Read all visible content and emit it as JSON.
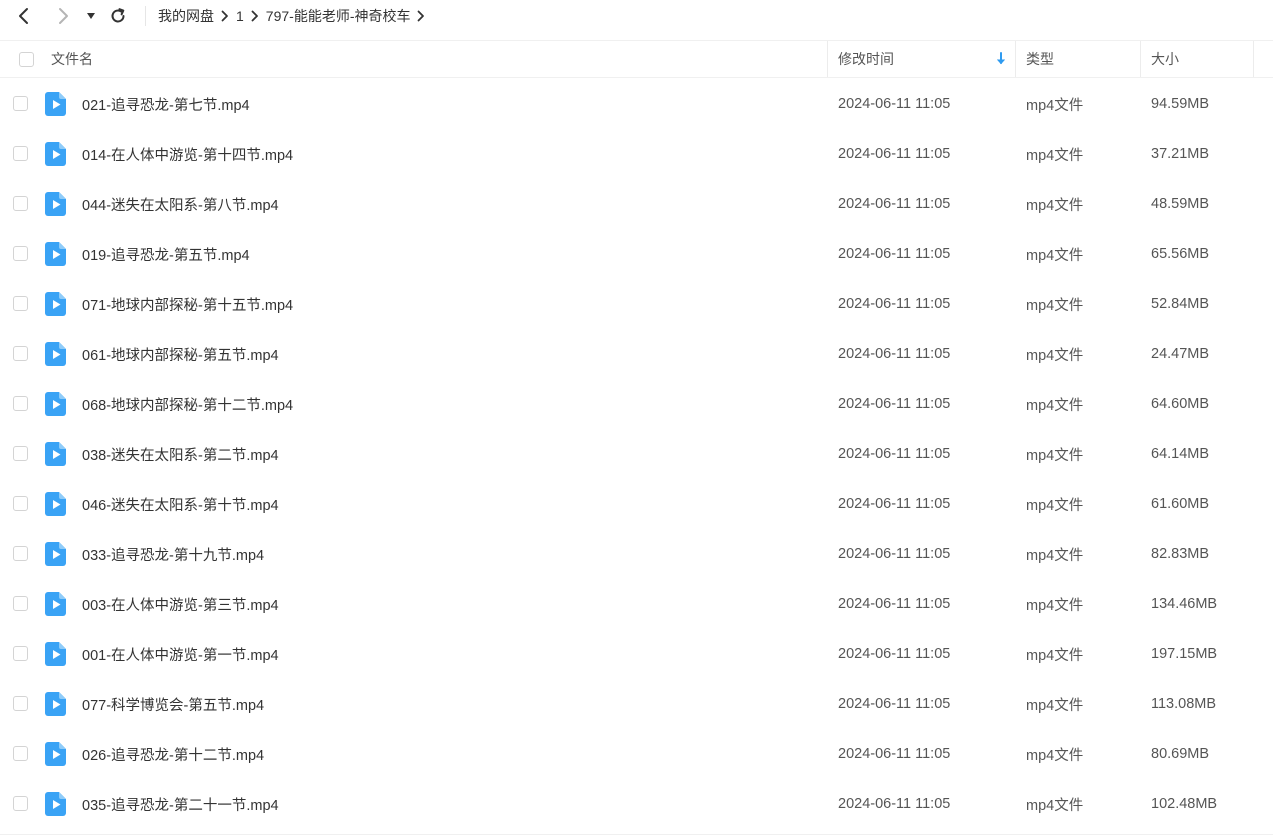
{
  "nav": {
    "back_icon": "chevron-left-icon",
    "forward_icon": "chevron-right-icon",
    "dropdown_icon": "caret-down-icon",
    "refresh_icon": "refresh-icon"
  },
  "breadcrumb": [
    "我的网盘",
    "1",
    "797-能能老师-神奇校车"
  ],
  "columns": {
    "name": "文件名",
    "modified": "修改时间",
    "type": "类型",
    "size": "大小"
  },
  "sort_icon": "arrow-down-icon",
  "colors": {
    "accent": "#2f9bf0",
    "icon_blue": "#3aa3f5"
  },
  "files": [
    {
      "name": "021-追寻恐龙-第七节.mp4",
      "modified": "2024-06-11 11:05",
      "type": "mp4文件",
      "size": "94.59MB"
    },
    {
      "name": "014-在人体中游览-第十四节.mp4",
      "modified": "2024-06-11 11:05",
      "type": "mp4文件",
      "size": "37.21MB"
    },
    {
      "name": "044-迷失在太阳系-第八节.mp4",
      "modified": "2024-06-11 11:05",
      "type": "mp4文件",
      "size": "48.59MB"
    },
    {
      "name": "019-追寻恐龙-第五节.mp4",
      "modified": "2024-06-11 11:05",
      "type": "mp4文件",
      "size": "65.56MB"
    },
    {
      "name": "071-地球内部探秘-第十五节.mp4",
      "modified": "2024-06-11 11:05",
      "type": "mp4文件",
      "size": "52.84MB"
    },
    {
      "name": "061-地球内部探秘-第五节.mp4",
      "modified": "2024-06-11 11:05",
      "type": "mp4文件",
      "size": "24.47MB"
    },
    {
      "name": "068-地球内部探秘-第十二节.mp4",
      "modified": "2024-06-11 11:05",
      "type": "mp4文件",
      "size": "64.60MB"
    },
    {
      "name": "038-迷失在太阳系-第二节.mp4",
      "modified": "2024-06-11 11:05",
      "type": "mp4文件",
      "size": "64.14MB"
    },
    {
      "name": "046-迷失在太阳系-第十节.mp4",
      "modified": "2024-06-11 11:05",
      "type": "mp4文件",
      "size": "61.60MB"
    },
    {
      "name": "033-追寻恐龙-第十九节.mp4",
      "modified": "2024-06-11 11:05",
      "type": "mp4文件",
      "size": "82.83MB"
    },
    {
      "name": "003-在人体中游览-第三节.mp4",
      "modified": "2024-06-11 11:05",
      "type": "mp4文件",
      "size": "134.46MB"
    },
    {
      "name": "001-在人体中游览-第一节.mp4",
      "modified": "2024-06-11 11:05",
      "type": "mp4文件",
      "size": "197.15MB"
    },
    {
      "name": "077-科学博览会-第五节.mp4",
      "modified": "2024-06-11 11:05",
      "type": "mp4文件",
      "size": "113.08MB"
    },
    {
      "name": "026-追寻恐龙-第十二节.mp4",
      "modified": "2024-06-11 11:05",
      "type": "mp4文件",
      "size": "80.69MB"
    },
    {
      "name": "035-追寻恐龙-第二十一节.mp4",
      "modified": "2024-06-11 11:05",
      "type": "mp4文件",
      "size": "102.48MB"
    }
  ]
}
